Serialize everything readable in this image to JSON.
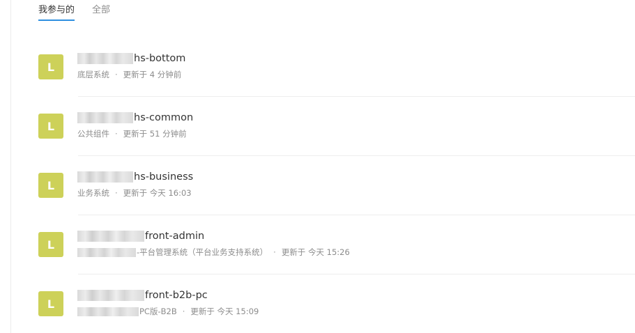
{
  "tabs": [
    {
      "label": "我参与的"
    },
    {
      "label": "全部"
    }
  ],
  "repos": [
    {
      "avatar": "L",
      "name": "hs-bottom",
      "desc": "底层系统",
      "updated": "更新于 4 分钟前"
    },
    {
      "avatar": "L",
      "name": "hs-common",
      "desc": "公共组件",
      "updated": "更新于 51 分钟前"
    },
    {
      "avatar": "L",
      "name": "hs-business",
      "desc": "业务系统",
      "updated": "更新于 今天 16:03"
    },
    {
      "avatar": "L",
      "name": "front-admin",
      "desc": "-平台管理系统（平台业务支持系统）",
      "updated": "更新于 今天 15:26"
    },
    {
      "avatar": "L",
      "name": "front-b2b-pc",
      "desc": "PC版-B2B",
      "updated": "更新于 今天 15:09"
    }
  ],
  "meta_separator": "·"
}
